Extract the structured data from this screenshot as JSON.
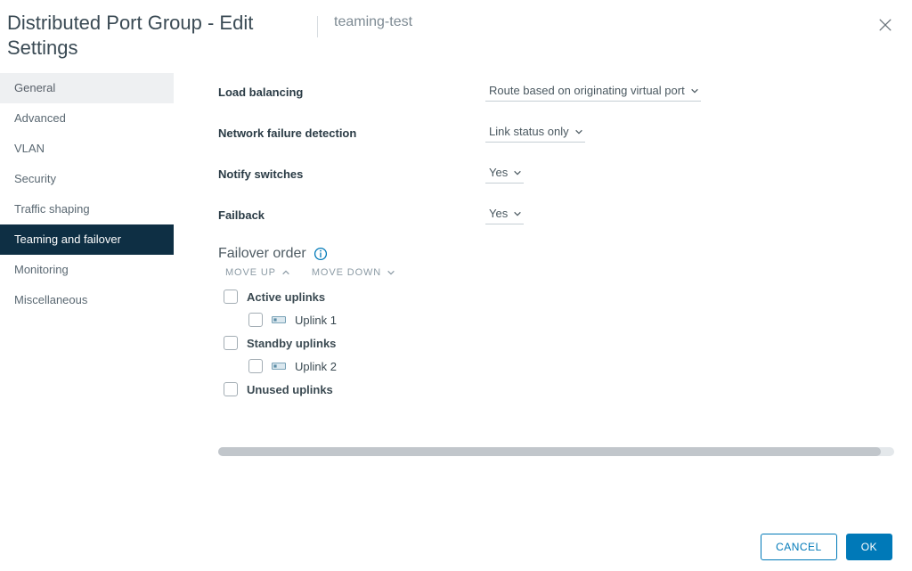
{
  "header": {
    "title": "Distributed Port Group - Edit Settings",
    "subtitle": "teaming-test"
  },
  "sidebar": {
    "items": [
      {
        "label": "General"
      },
      {
        "label": "Advanced"
      },
      {
        "label": "VLAN"
      },
      {
        "label": "Security"
      },
      {
        "label": "Traffic shaping"
      },
      {
        "label": "Teaming and failover"
      },
      {
        "label": "Monitoring"
      },
      {
        "label": "Miscellaneous"
      }
    ]
  },
  "form": {
    "load_balancing": {
      "label": "Load balancing",
      "value": "Route based on originating virtual port"
    },
    "nfd": {
      "label": "Network failure detection",
      "value": "Link status only"
    },
    "notify": {
      "label": "Notify switches",
      "value": "Yes"
    },
    "failback": {
      "label": "Failback",
      "value": "Yes"
    }
  },
  "failover": {
    "heading": "Failover order",
    "move_up": "MOVE UP",
    "move_down": "MOVE DOWN",
    "groups": {
      "active": {
        "label": "Active uplinks",
        "items": [
          {
            "label": "Uplink 1"
          }
        ]
      },
      "standby": {
        "label": "Standby uplinks",
        "items": [
          {
            "label": "Uplink 2"
          }
        ]
      },
      "unused": {
        "label": "Unused uplinks",
        "items": []
      }
    }
  },
  "footer": {
    "cancel": "CANCEL",
    "ok": "OK"
  }
}
